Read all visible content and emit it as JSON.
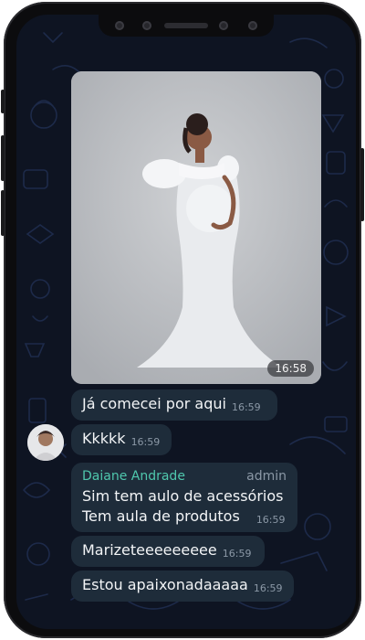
{
  "chat": {
    "photo_message": {
      "time": "16:58"
    },
    "messages": [
      {
        "text": "Já comecei por aqui",
        "time": "16:59"
      },
      {
        "text": "Kkkkk",
        "time": "16:59"
      },
      {
        "sender": "Daiane Andrade",
        "role": "admin",
        "line1": "Sim tem aulo de acessórios",
        "line2": "Tem aula de produtos",
        "time": "16:59"
      },
      {
        "text": "Marizeteeeeeeeee",
        "time": "16:59"
      },
      {
        "text": "Estou apaixonadaaaaa",
        "time": "16:59"
      }
    ]
  },
  "colors": {
    "bubble": "#1e2c3a",
    "sender_name": "#4fc7ad",
    "background": "#0e1422"
  }
}
